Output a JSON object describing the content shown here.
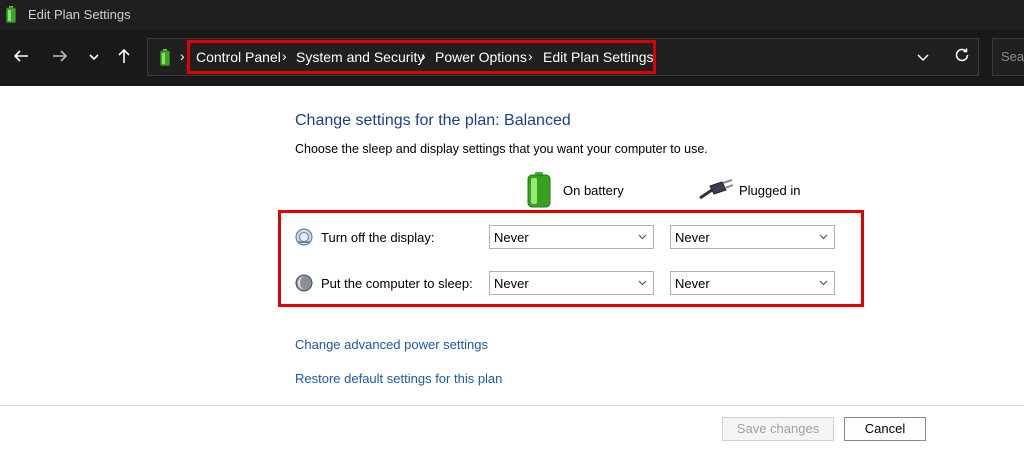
{
  "window": {
    "title": "Edit Plan Settings"
  },
  "nav": {
    "back_icon": "arrow-left-icon",
    "forward_icon": "arrow-right-icon",
    "recent_icon": "chevron-down-icon",
    "up_icon": "arrow-up-icon",
    "breadcrumbs": [
      "Control Panel",
      "System and Security",
      "Power Options",
      "Edit Plan Settings"
    ],
    "search_placeholder": "Search"
  },
  "main": {
    "heading": "Change settings for the plan: Balanced",
    "description": "Choose the sleep and display settings that you want your computer to use.",
    "columns": {
      "on_battery": "On battery",
      "plugged_in": "Plugged in"
    },
    "rows": [
      {
        "label": "Turn off the display:",
        "on_battery": "Never",
        "plugged_in": "Never",
        "icon": "display-icon"
      },
      {
        "label": "Put the computer to sleep:",
        "on_battery": "Never",
        "plugged_in": "Never",
        "icon": "sleep-moon-icon"
      }
    ],
    "links": {
      "advanced": "Change advanced power settings",
      "restore": "Restore default settings for this plan"
    }
  },
  "footer": {
    "save": "Save changes",
    "cancel": "Cancel"
  },
  "colors": {
    "highlight": "#e00000",
    "link": "#1a5aa8",
    "heading": "#1b3f8f",
    "chrome": "#191919"
  }
}
